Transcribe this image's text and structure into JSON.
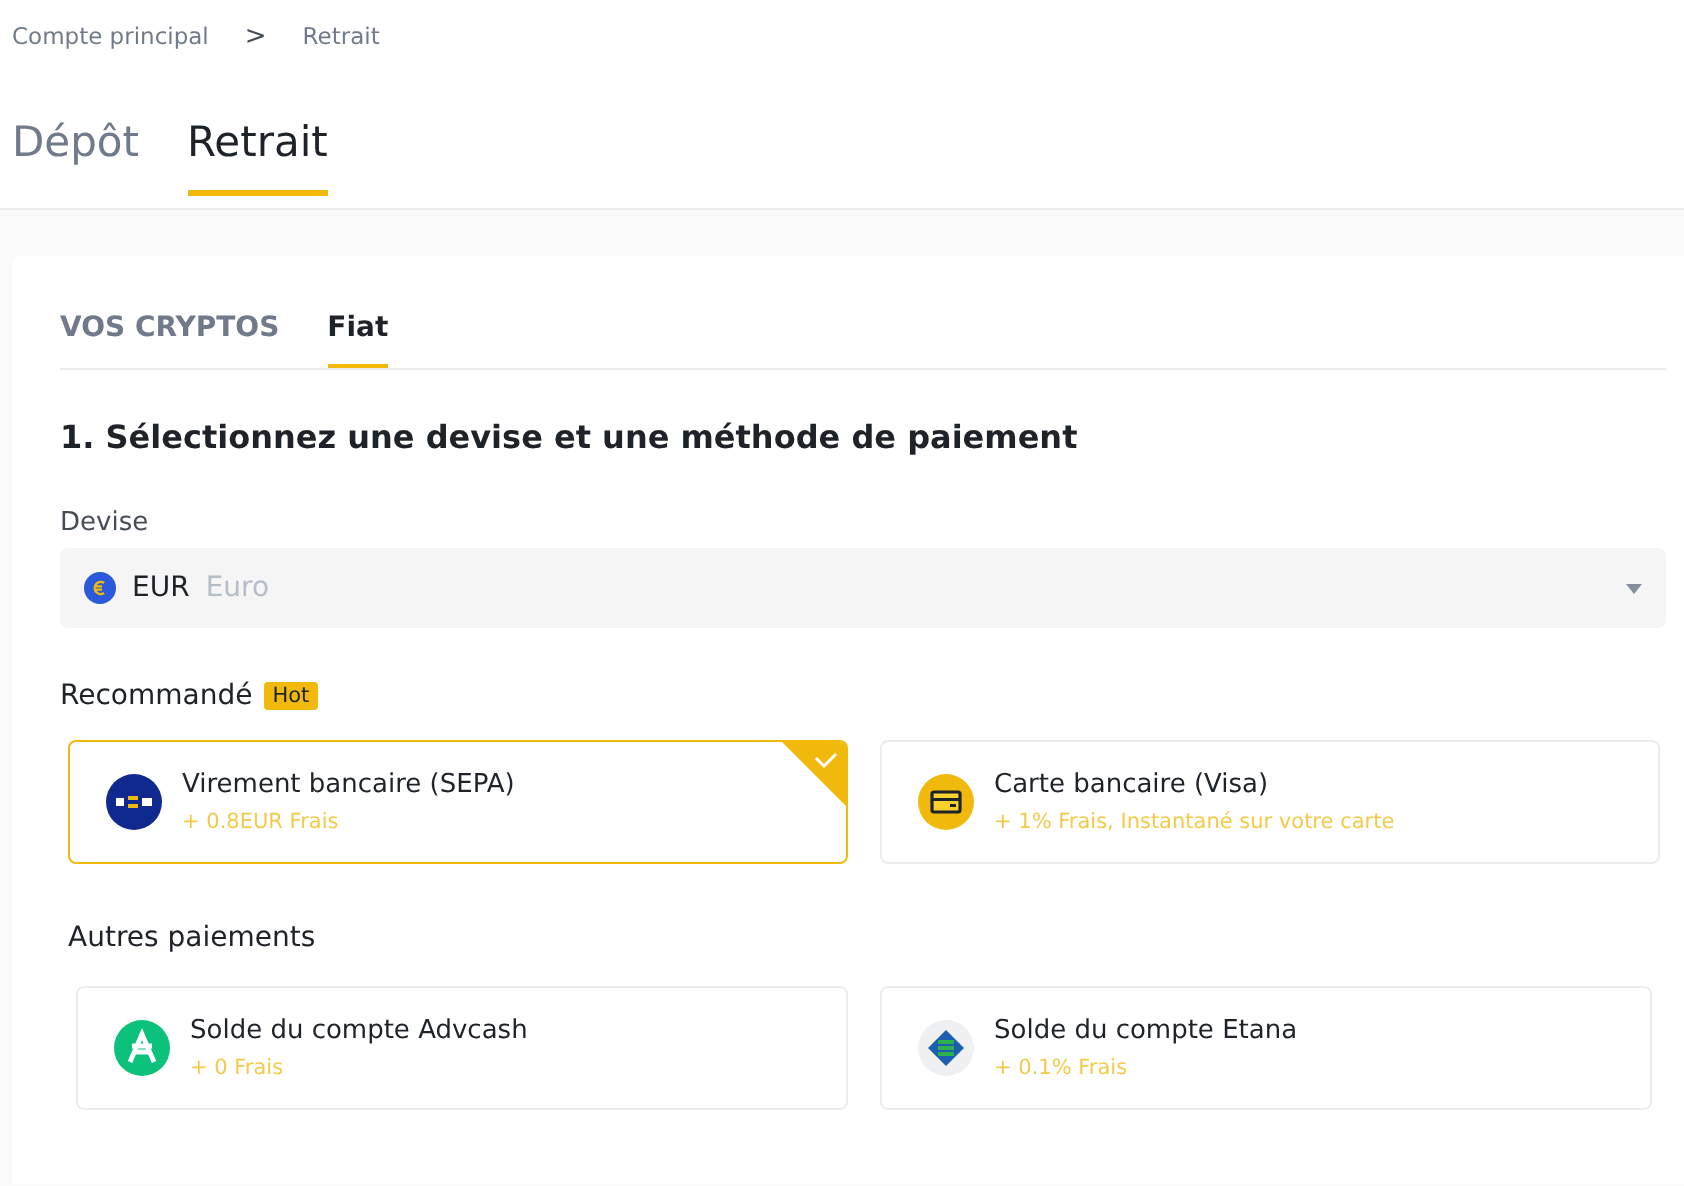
{
  "breadcrumb": [
    {
      "label": "Compte principal"
    },
    {
      "label": "Retrait"
    }
  ],
  "breadcrumb_separator": ">",
  "tabs": [
    {
      "label": "Dépôt",
      "selected": false
    },
    {
      "label": "Retrait",
      "selected": true
    }
  ],
  "asset_tabs": [
    {
      "label": "VOS CRYPTOS",
      "selected": false
    },
    {
      "label": "Fiat",
      "selected": true
    }
  ],
  "step_title": "1. Sélectionnez une devise et une méthode de paiement",
  "currency": {
    "label": "Devise",
    "code": "EUR",
    "name": "Euro"
  },
  "recommended": {
    "title": "Recommandé",
    "badge": "Hot",
    "methods": [
      {
        "kind": "sepa",
        "title": "Virement bancaire (SEPA)",
        "fee": "+ 0.8EUR Frais",
        "selected": true
      },
      {
        "kind": "card",
        "title": "Carte bancaire (Visa)",
        "fee": "+ 1% Frais, Instantané sur votre carte",
        "selected": false
      }
    ]
  },
  "other": {
    "title": "Autres paiements",
    "methods": [
      {
        "kind": "advcash",
        "title": "Solde du compte Advcash",
        "fee": "+ 0 Frais",
        "selected": false
      },
      {
        "kind": "etana",
        "title": "Solde du compte Etana",
        "fee": "+ 0.1% Frais",
        "selected": false
      }
    ]
  }
}
